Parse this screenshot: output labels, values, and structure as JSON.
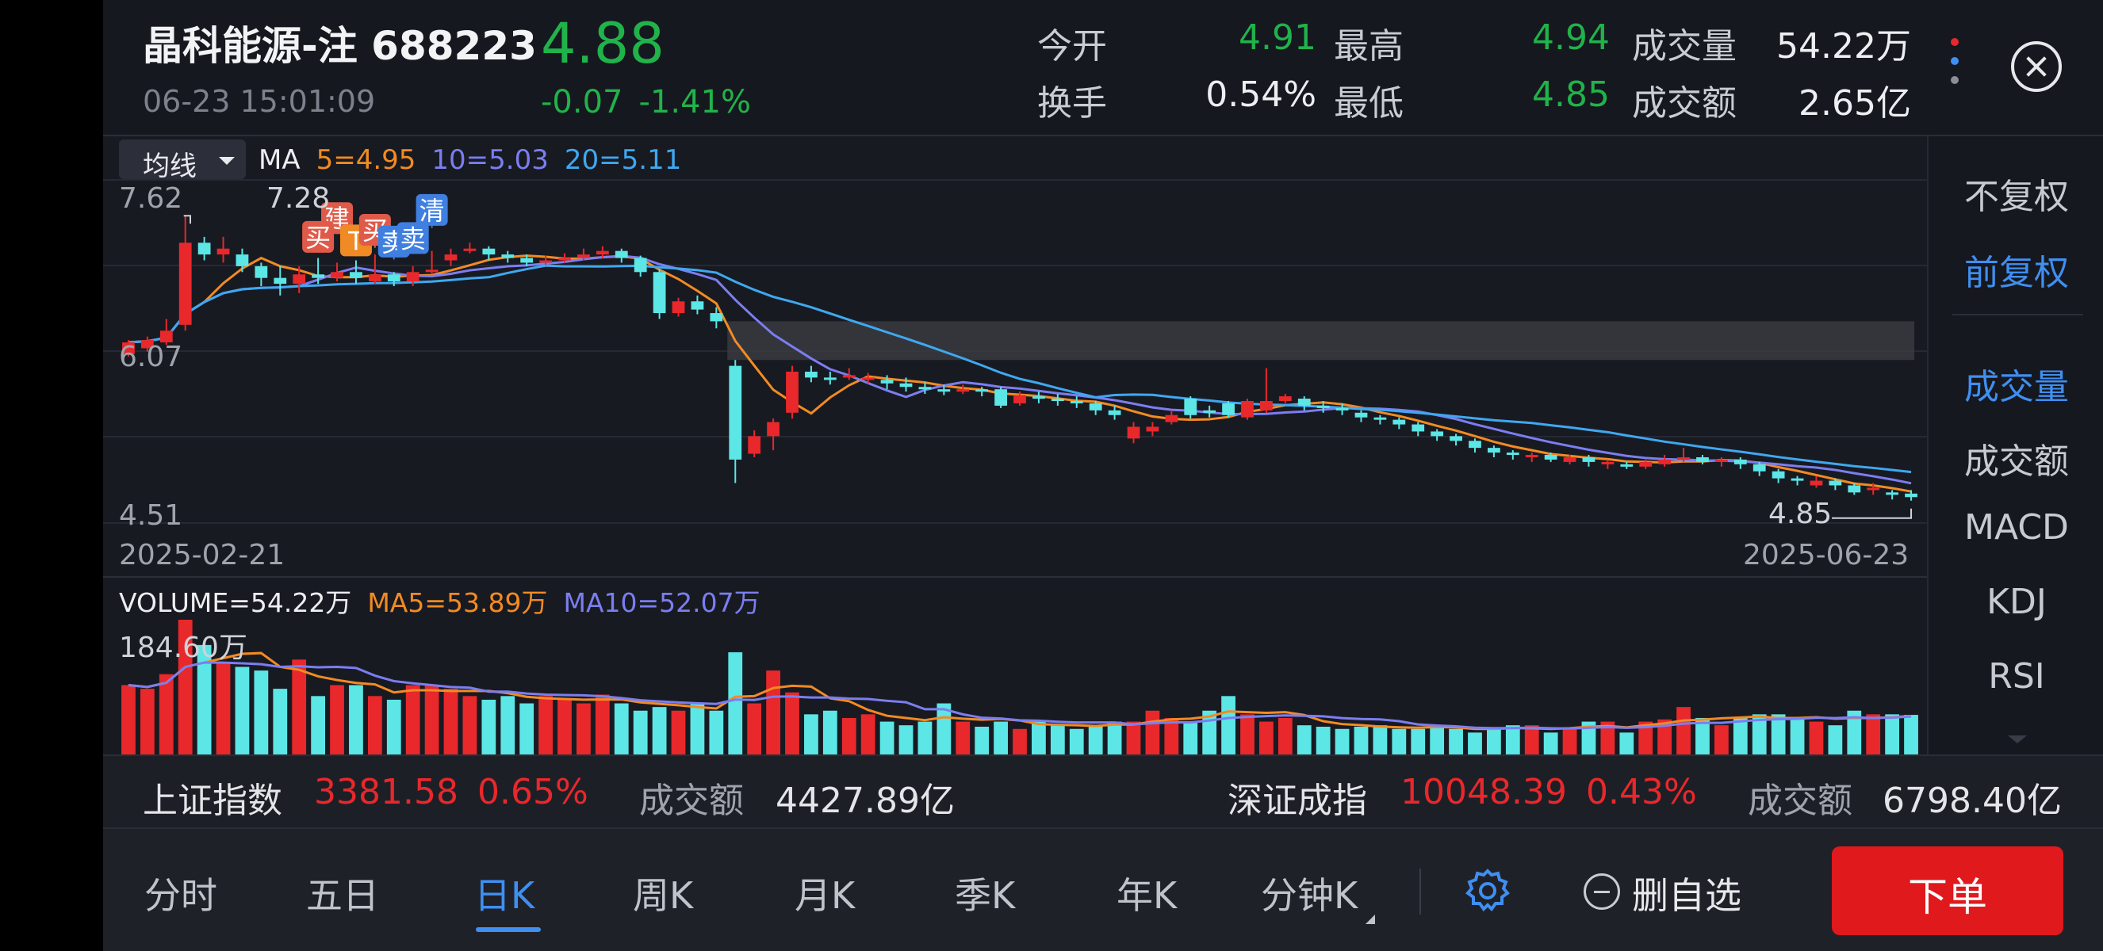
{
  "header": {
    "stock_name": "晶科能源-注 688223",
    "time": "06-23 15:01:09",
    "price": "4.88",
    "change": "-0.07",
    "change_pct": "-1.41%",
    "quotes": {
      "open_label": "今开",
      "open": "4.91",
      "high_label": "最高",
      "high": "4.94",
      "volume_label": "成交量",
      "volume": "54.22万",
      "turnover_label": "换手",
      "turnover": "0.54%",
      "low_label": "最低",
      "low": "4.85",
      "amount_label": "成交额",
      "amount": "2.65亿"
    }
  },
  "chart_header": {
    "ma_button": "均线",
    "ma_prefix": "MA",
    "ma5": "5=4.95",
    "ma10": "10=5.03",
    "ma20": "20=5.11"
  },
  "price_axis": {
    "top_label": "7.62",
    "mid_label": "6.07",
    "bottom_label": "4.51",
    "max_mark": "7.28",
    "min_mark": "4.85"
  },
  "date_axis": {
    "start": "2025-02-21",
    "end": "2025-06-23"
  },
  "volume_header": {
    "volume": "VOLUME=54.22万",
    "ma5": "MA5=53.89万",
    "ma10": "MA10=52.07万",
    "max_label": "184.60万"
  },
  "trade_marks": [
    "建",
    "买",
    "T",
    "买",
    "卖",
    "卖",
    "清"
  ],
  "side_panel": {
    "items": [
      "不复权",
      "前复权",
      "成交量",
      "成交额",
      "MACD",
      "KDJ",
      "RSI"
    ]
  },
  "index_bar": {
    "sh_name": "上证指数",
    "sh_value": "3381.58",
    "sh_pct": "0.65%",
    "sh_amount_label": "成交额",
    "sh_amount": "4427.89亿",
    "sz_name": "深证成指",
    "sz_value": "10048.39",
    "sz_pct": "0.43%",
    "sz_amount_label": "成交额",
    "sz_amount": "6798.40亿"
  },
  "tabs": [
    "分时",
    "五日",
    "日K",
    "周K",
    "月K",
    "季K",
    "年K",
    "分钟K"
  ],
  "actions": {
    "remove_watchlist": "删自选",
    "order": "下单"
  },
  "colors": {
    "up": "#e8282b",
    "down": "#5ce6e6",
    "ma5": "#f28b22",
    "ma10": "#7b7ef0",
    "ma20": "#3fa8f0",
    "accent": "#3f8ff2"
  },
  "chart_data": {
    "type": "candlestick",
    "x_range": [
      "2025-02-21",
      "2025-06-23"
    ],
    "ylim": [
      4.51,
      7.62
    ],
    "ohlc": [
      [
        6.1,
        6.2,
        6.22,
        6.08
      ],
      [
        6.15,
        6.22,
        6.25,
        6.12
      ],
      [
        6.2,
        6.3,
        6.4,
        6.18
      ],
      [
        6.35,
        7.05,
        7.28,
        6.3
      ],
      [
        7.05,
        6.95,
        7.1,
        6.9
      ],
      [
        6.95,
        7.0,
        7.1,
        6.88
      ],
      [
        6.95,
        6.85,
        7.0,
        6.8
      ],
      [
        6.85,
        6.75,
        6.88,
        6.68
      ],
      [
        6.75,
        6.7,
        6.85,
        6.6
      ],
      [
        6.7,
        6.78,
        6.85,
        6.62
      ],
      [
        6.78,
        6.75,
        6.92,
        6.7
      ],
      [
        6.75,
        6.8,
        6.88,
        6.72
      ],
      [
        6.8,
        6.75,
        6.9,
        6.7
      ],
      [
        6.72,
        6.78,
        6.95,
        6.7
      ],
      [
        6.78,
        6.72,
        6.8,
        6.68
      ],
      [
        6.72,
        6.8,
        6.85,
        6.68
      ],
      [
        6.8,
        6.82,
        6.98,
        6.78
      ],
      [
        6.9,
        6.95,
        7.0,
        6.85
      ],
      [
        6.98,
        7.0,
        7.05,
        6.96
      ],
      [
        7.0,
        6.95,
        7.02,
        6.9
      ],
      [
        6.95,
        6.92,
        6.98,
        6.88
      ],
      [
        6.92,
        6.88,
        6.95,
        6.85
      ],
      [
        6.88,
        6.9,
        6.94,
        6.86
      ],
      [
        6.9,
        6.92,
        6.96,
        6.88
      ],
      [
        6.92,
        6.95,
        7.0,
        6.9
      ],
      [
        6.95,
        6.98,
        7.02,
        6.92
      ],
      [
        6.98,
        6.92,
        7.0,
        6.88
      ],
      [
        6.92,
        6.8,
        6.94,
        6.76
      ],
      [
        6.8,
        6.45,
        6.82,
        6.4
      ],
      [
        6.45,
        6.55,
        6.58,
        6.42
      ],
      [
        6.55,
        6.48,
        6.6,
        6.44
      ],
      [
        6.45,
        6.38,
        6.5,
        6.32
      ],
      [
        6.0,
        5.2,
        6.05,
        5.0
      ],
      [
        5.25,
        5.4,
        5.45,
        5.22
      ],
      [
        5.4,
        5.52,
        5.55,
        5.28
      ],
      [
        5.6,
        5.95,
        6.0,
        5.55
      ],
      [
        5.95,
        5.9,
        6.0,
        5.86
      ],
      [
        5.9,
        5.88,
        5.95,
        5.84
      ],
      [
        5.9,
        5.92,
        5.98,
        5.88
      ],
      [
        5.9,
        5.9,
        5.94,
        5.85
      ],
      [
        5.88,
        5.85,
        5.92,
        5.8
      ],
      [
        5.85,
        5.82,
        5.9,
        5.78
      ],
      [
        5.82,
        5.8,
        5.86,
        5.76
      ],
      [
        5.8,
        5.78,
        5.84,
        5.75
      ],
      [
        5.78,
        5.8,
        5.84,
        5.76
      ],
      [
        5.8,
        5.78,
        5.82,
        5.74
      ],
      [
        5.8,
        5.66,
        5.82,
        5.64
      ],
      [
        5.68,
        5.75,
        5.78,
        5.66
      ],
      [
        5.74,
        5.72,
        5.78,
        5.68
      ],
      [
        5.72,
        5.7,
        5.76,
        5.66
      ],
      [
        5.7,
        5.68,
        5.74,
        5.64
      ],
      [
        5.68,
        5.62,
        5.7,
        5.58
      ],
      [
        5.62,
        5.58,
        5.66,
        5.54
      ],
      [
        5.38,
        5.48,
        5.52,
        5.34
      ],
      [
        5.44,
        5.48,
        5.52,
        5.4
      ],
      [
        5.52,
        5.58,
        5.62,
        5.5
      ],
      [
        5.72,
        5.58,
        5.74,
        5.55
      ],
      [
        5.62,
        5.6,
        5.66,
        5.56
      ],
      [
        5.68,
        5.58,
        5.7,
        5.56
      ],
      [
        5.56,
        5.7,
        5.72,
        5.54
      ],
      [
        5.62,
        5.7,
        5.98,
        5.6
      ],
      [
        5.7,
        5.74,
        5.76,
        5.68
      ],
      [
        5.72,
        5.66,
        5.74,
        5.62
      ],
      [
        5.66,
        5.64,
        5.7,
        5.6
      ],
      [
        5.64,
        5.62,
        5.68,
        5.58
      ],
      [
        5.6,
        5.56,
        5.62,
        5.52
      ],
      [
        5.56,
        5.54,
        5.58,
        5.5
      ],
      [
        5.54,
        5.5,
        5.56,
        5.46
      ],
      [
        5.5,
        5.44,
        5.52,
        5.4
      ],
      [
        5.44,
        5.4,
        5.46,
        5.36
      ],
      [
        5.4,
        5.36,
        5.42,
        5.32
      ],
      [
        5.36,
        5.3,
        5.38,
        5.26
      ],
      [
        5.3,
        5.26,
        5.32,
        5.22
      ],
      [
        5.26,
        5.24,
        5.28,
        5.2
      ],
      [
        5.22,
        5.24,
        5.26,
        5.18
      ],
      [
        5.24,
        5.2,
        5.26,
        5.18
      ],
      [
        5.18,
        5.22,
        5.24,
        5.16
      ],
      [
        5.22,
        5.18,
        5.24,
        5.14
      ],
      [
        5.16,
        5.18,
        5.2,
        5.12
      ],
      [
        5.16,
        5.14,
        5.18,
        5.12
      ],
      [
        5.14,
        5.18,
        5.2,
        5.12
      ],
      [
        5.16,
        5.2,
        5.24,
        5.14
      ],
      [
        5.2,
        5.22,
        5.3,
        5.18
      ],
      [
        5.22,
        5.18,
        5.24,
        5.16
      ],
      [
        5.18,
        5.2,
        5.22,
        5.14
      ],
      [
        5.2,
        5.16,
        5.22,
        5.12
      ],
      [
        5.16,
        5.1,
        5.18,
        5.06
      ],
      [
        5.1,
        5.04,
        5.12,
        5.0
      ],
      [
        5.04,
        5.02,
        5.06,
        4.98
      ],
      [
        4.98,
        5.02,
        5.06,
        4.96
      ],
      [
        5.02,
        4.98,
        5.04,
        4.94
      ],
      [
        4.98,
        4.92,
        5.0,
        4.9
      ],
      [
        4.95,
        4.96,
        5.0,
        4.9
      ],
      [
        4.92,
        4.9,
        4.94,
        4.86
      ],
      [
        4.91,
        4.88,
        4.94,
        4.85
      ]
    ],
    "volume_wan": [
      95,
      90,
      110,
      184.6,
      150,
      125,
      120,
      115,
      90,
      130,
      80,
      95,
      95,
      80,
      75,
      95,
      95,
      90,
      80,
      75,
      80,
      70,
      80,
      75,
      70,
      82,
      70,
      60,
      65,
      60,
      70,
      60,
      140,
      70,
      115,
      85,
      55,
      60,
      50,
      55,
      45,
      40,
      45,
      70,
      45,
      38,
      45,
      35,
      45,
      40,
      35,
      40,
      45,
      45,
      60,
      50,
      45,
      60,
      80,
      55,
      45,
      50,
      40,
      38,
      35,
      38,
      40,
      35,
      35,
      40,
      35,
      30,
      35,
      40,
      40,
      30,
      35,
      45,
      45,
      30,
      45,
      48,
      65,
      50,
      40,
      50,
      55,
      55,
      50,
      45,
      40,
      60,
      55,
      55,
      54.22
    ],
    "ma_lines": [
      "MA5",
      "MA10",
      "MA20"
    ],
    "volume_ma_lines": [
      "MA5",
      "MA10"
    ]
  }
}
